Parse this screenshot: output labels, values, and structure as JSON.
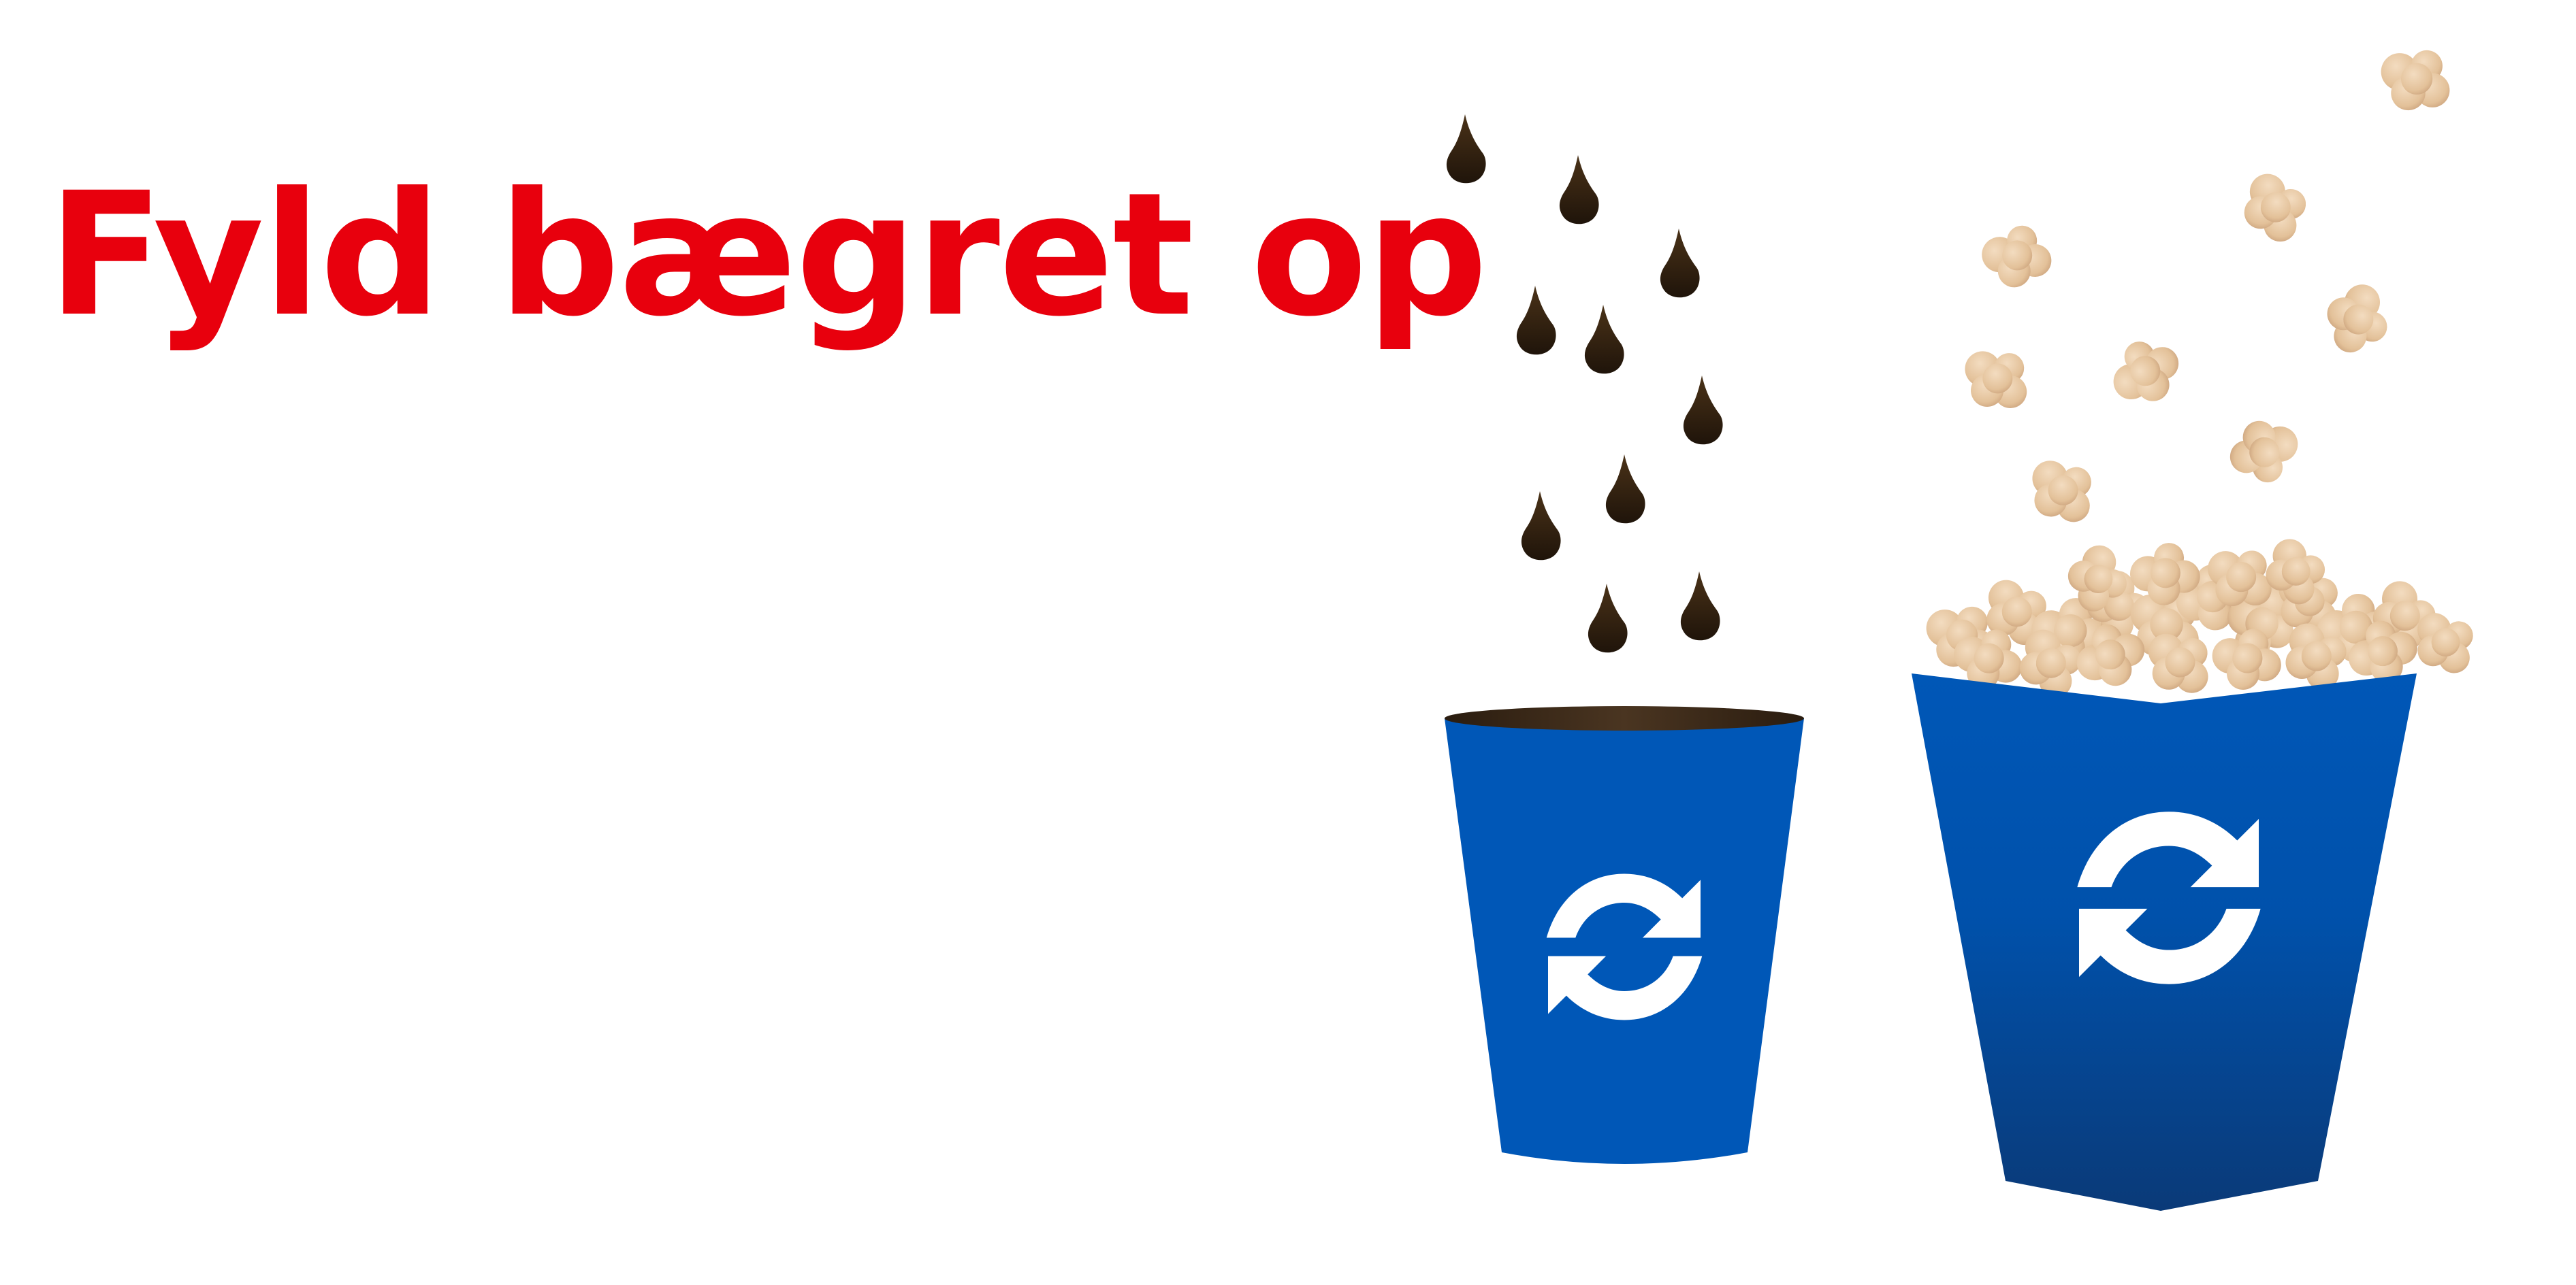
{
  "headline": {
    "text": "Fyld bægret op"
  },
  "colors": {
    "headline": "#e8000d",
    "cup_blue": "#0057b7",
    "cup_blue_dark": "#0a3a78",
    "coffee": "#2b1d10",
    "popcorn": "#e6c49c",
    "icon": "#ffffff"
  },
  "illustration": {
    "drink_cup": {
      "icon": "recycle-arrows-icon",
      "contents": "coffee-drops"
    },
    "popcorn_bucket": {
      "icon": "recycle-arrows-icon",
      "contents": "popcorn"
    }
  }
}
